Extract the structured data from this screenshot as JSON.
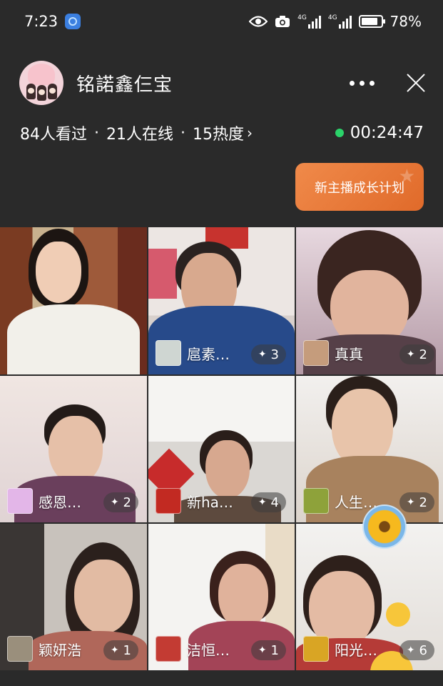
{
  "status_bar": {
    "time": "7:23",
    "battery": "78%",
    "network_1": "4G",
    "network_2": "4G"
  },
  "header": {
    "title": "铭諾鑫仨宝"
  },
  "stats": {
    "viewers": "84人看过",
    "online": "21人在线",
    "heat": "15热度",
    "separator": "·",
    "duration": "00:24:47"
  },
  "promo": {
    "label": "新主播成长计划"
  },
  "participants": [
    {
      "name": "",
      "count": ""
    },
    {
      "name": "扈素…",
      "count": "3"
    },
    {
      "name": "真真",
      "count": "2"
    },
    {
      "name": "感恩…",
      "count": "2"
    },
    {
      "name": "新ha…",
      "count": "4"
    },
    {
      "name": "人生…",
      "count": "2"
    },
    {
      "name": "颖妍浩",
      "count": "1"
    },
    {
      "name": "洁恒…",
      "count": "1"
    },
    {
      "name": "阳光…",
      "count": "6"
    }
  ],
  "colors": {
    "background": "#2a2a2a",
    "live_dot": "#2bd36a",
    "promo_orange": "#e8783a"
  }
}
